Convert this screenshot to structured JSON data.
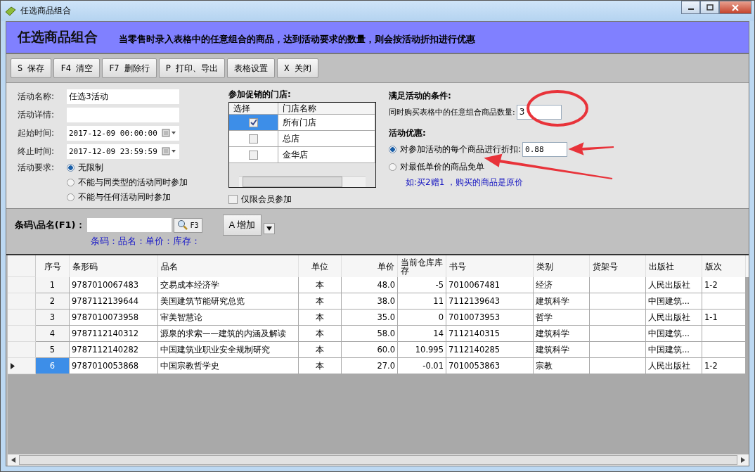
{
  "window": {
    "title": "任选商品组合"
  },
  "header": {
    "title": "任选商品组合",
    "description": "当零售时录入表格中的任意组合的商品，达到活动要求的数量，则会按活动折扣进行优惠"
  },
  "toolbar": [
    "S 保存",
    "F4 清空",
    "F7 删除行",
    "P 打印、导出",
    "表格设置",
    "X 关闭"
  ],
  "form": {
    "fields": [
      {
        "label": "活动名称:",
        "value": "任选3活动",
        "kind": "text"
      },
      {
        "label": "活动详情:",
        "kind": "text"
      },
      {
        "label": "起始时间:",
        "value": "2017-12-09 00:00:00",
        "kind": "date"
      },
      {
        "label": "终止时间:",
        "value": "2017-12-09 23:59:59",
        "kind": "date"
      }
    ],
    "requirement": {
      "label": "活动要求:",
      "options": [
        {
          "label": "无限制",
          "selected": true
        },
        {
          "label": "不能与同类型的活动同时参加",
          "selected": false
        },
        {
          "label": "不能与任何活动同时参加",
          "selected": false
        }
      ]
    }
  },
  "stores": {
    "title": "参加促销的门店:",
    "columns": [
      "选择",
      "门店名称"
    ],
    "rows": [
      {
        "name": "所有门店",
        "checked": true,
        "selected": true
      },
      {
        "name": "总店",
        "checked": false,
        "selected": false
      },
      {
        "name": "金华店",
        "checked": false,
        "selected": false
      }
    ],
    "members_only": {
      "label": "仅限会员参加",
      "checked": false
    }
  },
  "conditions": {
    "title": "满足活动的条件:",
    "quantity_label": "同时购买表格中的任意组合商品数量:",
    "quantity_value": "3"
  },
  "discount": {
    "title": "活动优惠:",
    "options": [
      {
        "label": "对参加活动的每个商品进行折扣:",
        "selected": true,
        "value": "0.88"
      },
      {
        "label": "对最低单价的商品免单",
        "selected": false
      }
    ],
    "hint": "如:买2赠1 ，购买的商品是原价"
  },
  "search": {
    "label": "条码\\品名(F1)：",
    "button": "F3",
    "add": "A 增加",
    "info": "条码：品名：单价：库存："
  },
  "table": {
    "columns": [
      "序号",
      "条形码",
      "品名",
      "单位",
      "单价",
      "当前仓库库存",
      "书号",
      "类别",
      "货架号",
      "出版社",
      "版次"
    ],
    "rows": [
      {
        "current": false,
        "cells": [
          "1",
          "9787010067483",
          "交易成本经济学",
          "本",
          "48.0",
          "-5",
          "7010067481",
          "经济",
          "",
          "人民出版社",
          "1-2"
        ]
      },
      {
        "current": false,
        "cells": [
          "2",
          "9787112139644",
          "美国建筑节能研究总览",
          "本",
          "38.0",
          "11",
          "7112139643",
          "建筑科学",
          "",
          "中国建筑...",
          ""
        ]
      },
      {
        "current": false,
        "cells": [
          "3",
          "9787010073958",
          "审美智慧论",
          "本",
          "35.0",
          "0",
          "7010073953",
          "哲学",
          "",
          "人民出版社",
          "1-1"
        ]
      },
      {
        "current": false,
        "cells": [
          "4",
          "9787112140312",
          "源泉的求索——建筑的内涵及解读",
          "本",
          "58.0",
          "14",
          "7112140315",
          "建筑科学",
          "",
          "中国建筑...",
          ""
        ]
      },
      {
        "current": false,
        "cells": [
          "5",
          "9787112140282",
          "中国建筑业职业安全规制研究",
          "本",
          "60.0",
          "10.995",
          "7112140285",
          "建筑科学",
          "",
          "中国建筑...",
          ""
        ]
      },
      {
        "current": true,
        "cells": [
          "6",
          "9787010053868",
          "中国宗教哲学史",
          "本",
          "27.0",
          "-0.01",
          "7010053863",
          "宗教",
          "",
          "人民出版社",
          "1-2"
        ]
      }
    ]
  }
}
